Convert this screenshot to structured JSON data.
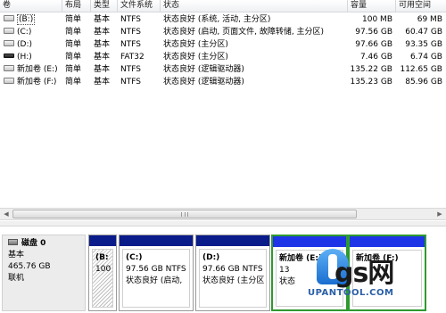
{
  "columns": [
    "卷",
    "布局",
    "类型",
    "文件系统",
    "状态",
    "容量",
    "可用空间"
  ],
  "volumes": [
    {
      "name": "(B:)",
      "layout": "简单",
      "type": "基本",
      "fs": "NTFS",
      "status": "状态良好 (系统, 活动, 主分区)",
      "capacity": "100 MB",
      "free": "69 MB",
      "selected": true,
      "icon": "drive-icon"
    },
    {
      "name": "(C:)",
      "layout": "简单",
      "type": "基本",
      "fs": "NTFS",
      "status": "状态良好 (启动, 页面文件, 故障转储, 主分区)",
      "capacity": "97.56 GB",
      "free": "60.47 GB",
      "icon": "drive-icon"
    },
    {
      "name": "(D:)",
      "layout": "简单",
      "type": "基本",
      "fs": "NTFS",
      "status": "状态良好 (主分区)",
      "capacity": "97.66 GB",
      "free": "93.35 GB",
      "icon": "drive-icon"
    },
    {
      "name": "(H:)",
      "layout": "简单",
      "type": "基本",
      "fs": "FAT32",
      "status": "状态良好 (主分区)",
      "capacity": "7.46 GB",
      "free": "6.74 GB",
      "icon": "usb-drive-icon"
    },
    {
      "name": "新加卷 (E:)",
      "layout": "简单",
      "type": "基本",
      "fs": "NTFS",
      "status": "状态良好 (逻辑驱动器)",
      "capacity": "135.22 GB",
      "free": "112.65 GB",
      "icon": "drive-icon"
    },
    {
      "name": "新加卷 (F:)",
      "layout": "简单",
      "type": "基本",
      "fs": "NTFS",
      "status": "状态良好 (逻辑驱动器)",
      "capacity": "135.23 GB",
      "free": "85.96 GB",
      "icon": "drive-icon"
    }
  ],
  "disk": {
    "title": "磁盘 0",
    "type": "基本",
    "size": "465.76 GB",
    "status": "联机"
  },
  "partitions": [
    {
      "name": "(B:",
      "line2": "100",
      "line3": "",
      "bar_color": "#0a1b8a",
      "hatched": true
    },
    {
      "name": "(C:)",
      "line2": "97.56 GB NTFS",
      "line3": "状态良好 (启动,",
      "bar_color": "#0a1b8a"
    },
    {
      "name": "(D:)",
      "line2": "97.66 GB NTFS",
      "line3": "状态良好 (主分区",
      "bar_color": "#0a1b8a"
    },
    {
      "name": "新加卷 (E:)",
      "line2": "13",
      "line3": "状态",
      "bar_color": "#1d35e6",
      "selected": true
    },
    {
      "name": "新加卷 (F:)",
      "line2": "",
      "line3": "",
      "bar_color": "#1d35e6",
      "selected": true
    }
  ],
  "scrollbar": {
    "left_arrow": "◀",
    "right_arrow": "▶"
  },
  "watermark": {
    "text": "gs网",
    "url": "UPANTOOL.COM"
  },
  "colors": {
    "primary_partition": "#0a1b8a",
    "logical_partition": "#1d35e6",
    "selection": "#2f9a2f"
  }
}
